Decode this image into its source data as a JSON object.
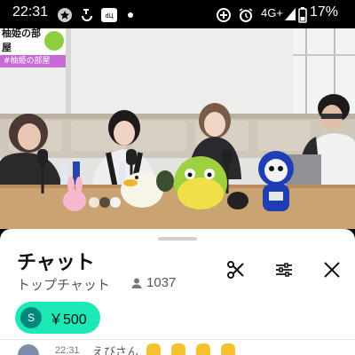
{
  "status_bar": {
    "time": "22:31",
    "network": "4G+",
    "battery": "17%",
    "icons": [
      "google-star-icon",
      "loading-arrow-icon",
      "app-badge-icon",
      "dot-icon",
      "data-saver-icon",
      "alarm-icon",
      "signal-icon",
      "battery-icon"
    ]
  },
  "video": {
    "channel_tag": "#柚姫の部屋",
    "logo_text": "柚姫の部屋"
  },
  "chat": {
    "title": "チャット",
    "mode": "トップチャット",
    "viewer_count": "1037",
    "buttons": [
      "scissors-icon",
      "filter-icon",
      "close-icon"
    ],
    "superchat": {
      "avatar_initial": "S",
      "amount": "￥500",
      "color": "#1de9b6"
    },
    "message": {
      "time": "22:31",
      "author": "えびさん"
    }
  }
}
